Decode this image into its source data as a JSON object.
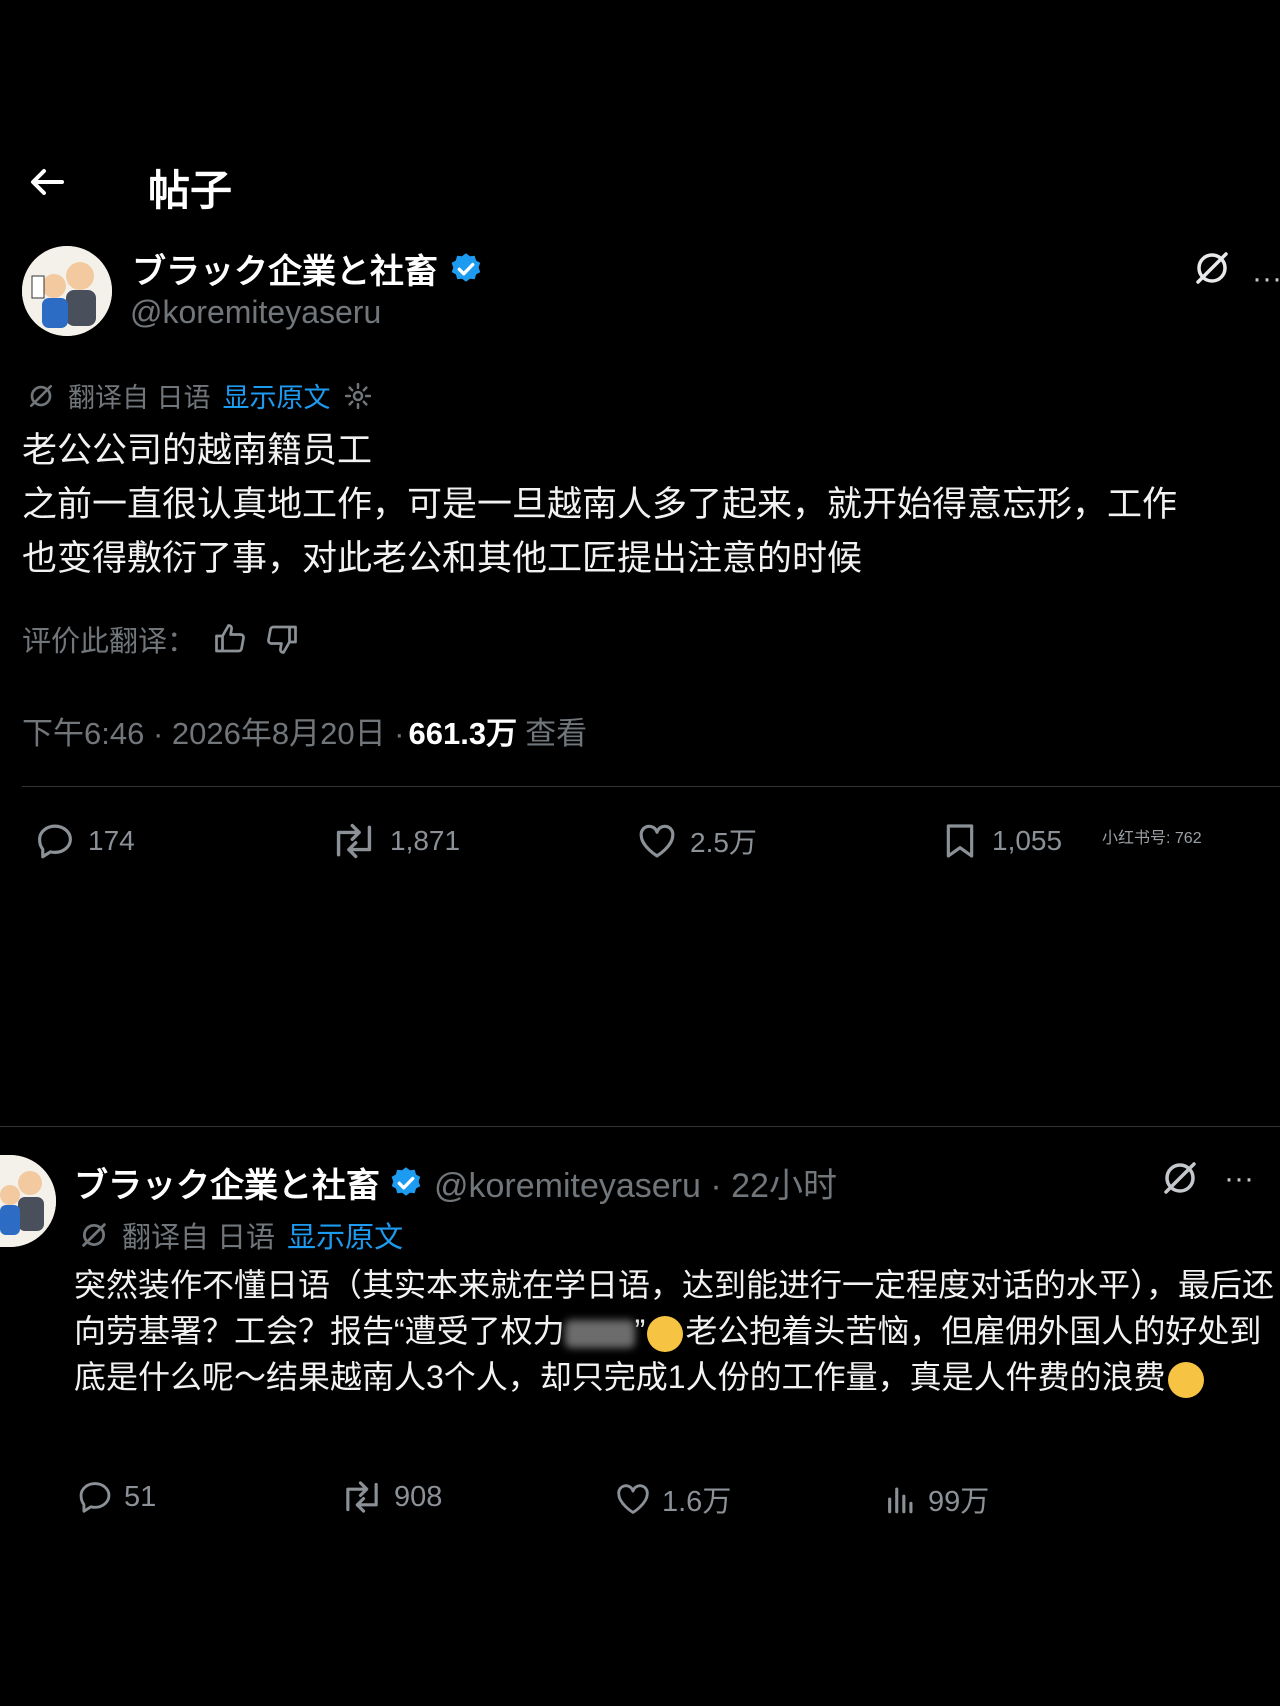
{
  "header": {
    "title": "帖子"
  },
  "tweet": {
    "author_name": "ブラック企業と社畜",
    "handle": "@koremiteyaseru",
    "translated_from": "翻译自 日语",
    "show_original": "显示原文",
    "body_lines": [
      "老公公司的越南籍员工",
      "之前一直很认真地工作，可是一旦越南人多了起来，就开始得意忘形，工作",
      "也变得敷衍了事，对此老公和其他工匠提出注意的时候"
    ],
    "rate_translation": "评价此翻译：",
    "time": "下午6:46 · 2026年8月20日 ·",
    "views_count": "661.3万",
    "views_label": "查看",
    "stats": {
      "replies": "174",
      "retweets": "1,871",
      "likes": "2.5万",
      "bookmarks": "1,055"
    },
    "watermark": "小红书号: 762"
  },
  "reply": {
    "author_name": "ブラック企業と社畜",
    "handle_time": "@koremiteyaseru · 22小时",
    "translated_from": "翻译自 日语",
    "show_original": "显示原文",
    "body_part1": "突然装作不懂日语（其实本来就在学日语，达到能进行一定程度对话的水平），最后还向劳基署？工会？报告“遭受了权力",
    "body_part2": "”",
    "body_part3": "老公抱着头苦恼，但雇佣外国人的好处到底是什么呢～结果越南人3个人，却只完成1人份的工作量，真是人件费的浪费",
    "stats": {
      "replies": "51",
      "retweets": "908",
      "likes": "1.6万",
      "views": "99万"
    }
  },
  "colors": {
    "background": "#000000",
    "link": "#1d9bf0",
    "verified": "#1d9bf0",
    "muted": "#71767b"
  }
}
